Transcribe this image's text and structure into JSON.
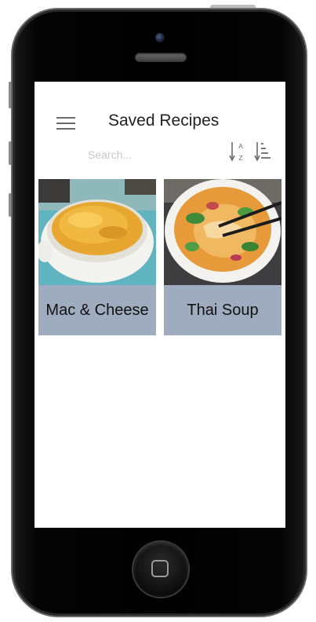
{
  "header": {
    "title": "Saved Recipes"
  },
  "search": {
    "placeholder": "Search..."
  },
  "sort": {
    "az_letter_a": "A",
    "az_letter_z": "Z"
  },
  "recipes": [
    {
      "title": "Mac & Cheese"
    },
    {
      "title": "Thai Soup"
    }
  ],
  "colors": {
    "card_background": "#9fabbf",
    "icon_gray": "#6b6b6b"
  }
}
